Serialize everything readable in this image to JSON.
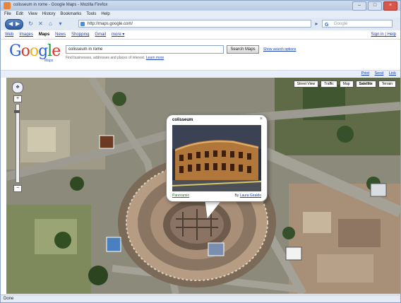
{
  "window": {
    "title": "colisseum in rome - Google Maps - Mozilla Firefox"
  },
  "menu": [
    "File",
    "Edit",
    "View",
    "History",
    "Bookmarks",
    "Tools",
    "Help"
  ],
  "nav": {
    "url": "http://maps.google.com/",
    "search_placeholder": "Google"
  },
  "gbar": {
    "links": [
      "Web",
      "Images",
      "Maps",
      "News",
      "Shopping",
      "Gmail",
      "more ▾"
    ],
    "active": "Maps",
    "right": "Sign in | Help"
  },
  "logo": {
    "sub": "Maps"
  },
  "search": {
    "query": "colisseum in rome",
    "button": "Search Maps",
    "link": "Show search options",
    "hint": "Find businesses, addresses and places of interest.",
    "hint_link": "Learn more"
  },
  "linkbar": [
    "Print",
    "Send",
    "Link"
  ],
  "maptypes": [
    "Street View",
    "Traffic",
    "Map",
    "Satellite",
    "Terrain"
  ],
  "map_active": "Satellite",
  "zoom": {
    "pan": "✥",
    "plus": "+",
    "minus": "−"
  },
  "balloon": {
    "title": "colisseum",
    "close": "×",
    "left_link": "Panoramio",
    "right_prefix": "By",
    "right_link": "Laura Giraldo"
  },
  "status": "Done"
}
